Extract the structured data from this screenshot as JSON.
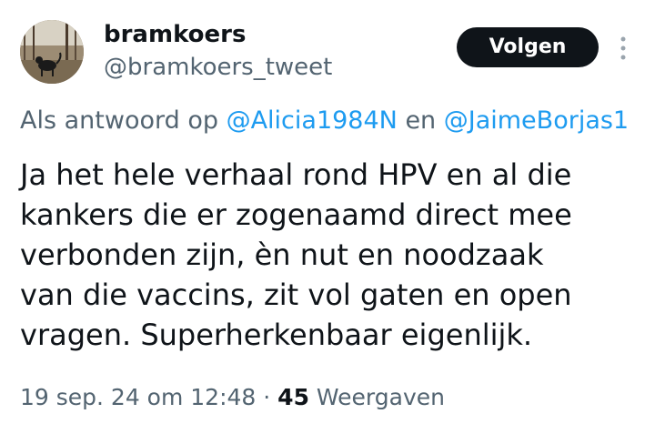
{
  "author": {
    "display_name": "bramkoers",
    "handle": "@bramkoers_tweet"
  },
  "follow_button_label": "Volgen",
  "more_icon": "vertical-ellipsis",
  "reply_context": {
    "prefix": "Als antwoord op ",
    "mention_1": "@Alicia1984N",
    "connector": " en ",
    "mention_2": "@JaimeBorjas1"
  },
  "tweet_text_lines": [
    "Ja het hele verhaal rond HPV en al die",
    "kankers die er zogenaamd direct mee",
    "verbonden zijn, èn nut en noodzaak",
    "van die vaccins, zit vol gaten en open",
    "vragen. Superherkenbaar eigenlijk."
  ],
  "meta": {
    "timestamp": "19 sep. 24 om 12:48",
    "separator": " · ",
    "views_count": "45",
    "views_label": " Weergaven"
  },
  "colors": {
    "text_primary": "#0f1419",
    "text_secondary": "#536471",
    "link": "#1d9bf0",
    "button_bg": "#0f1419"
  }
}
